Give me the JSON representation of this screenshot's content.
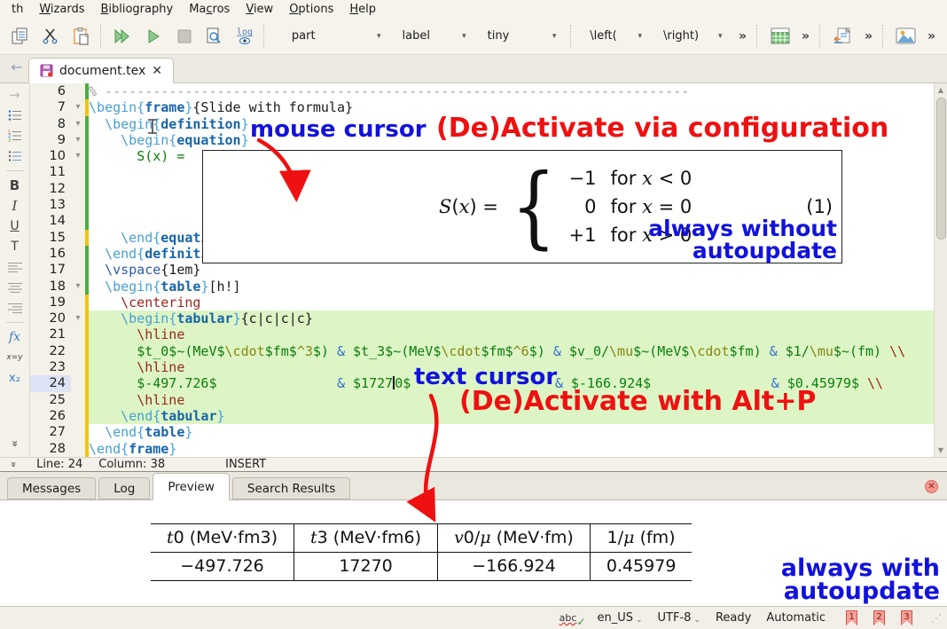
{
  "menu": {
    "items": [
      {
        "name": "overflow",
        "pre": "th",
        "key": "",
        "post": ""
      },
      {
        "name": "wizards",
        "pre": "",
        "key": "W",
        "post": "izards"
      },
      {
        "name": "bibliography",
        "pre": "",
        "key": "B",
        "post": "ibliography"
      },
      {
        "name": "macros",
        "pre": "Ma",
        "key": "c",
        "post": "ros"
      },
      {
        "name": "view",
        "pre": "",
        "key": "V",
        "post": "iew"
      },
      {
        "name": "options",
        "pre": "",
        "key": "O",
        "post": "ptions"
      },
      {
        "name": "help",
        "pre": "",
        "key": "H",
        "post": "elp"
      }
    ]
  },
  "toolbar": {
    "part_dropdown": "part",
    "label_dropdown": "label",
    "tiny_dropdown": "tiny",
    "left_dropdown": "\\left(",
    "right_dropdown": "\\right)",
    "overflow": "»",
    "arrow": "▾"
  },
  "tabbar": {
    "back": "←",
    "tab_title": "document.tex",
    "close": "✕"
  },
  "sidebar": {
    "items": [
      {
        "name": "nav-forward",
        "g": "→",
        "style": "color:#b9b9b9;font-size:15px"
      },
      {
        "name": "bullet-list",
        "svg": "list-dot"
      },
      {
        "name": "numbered-list",
        "svg": "list-num"
      },
      {
        "name": "description-list",
        "svg": "list-dot2"
      },
      {
        "name": "divider"
      },
      {
        "name": "bold",
        "g": "B",
        "style": "font-weight:bold;font-size:15px"
      },
      {
        "name": "italic",
        "g": "I",
        "style": "font-style:italic;font-family:'DejaVu Serif',serif;font-size:15px"
      },
      {
        "name": "underline",
        "g": "U",
        "style": "text-decoration:underline;font-size:14px"
      },
      {
        "name": "text-style",
        "g": "T",
        "style": "font-size:14px"
      },
      {
        "name": "align-left",
        "svg": "al"
      },
      {
        "name": "align-center",
        "svg": "ac"
      },
      {
        "name": "align-right",
        "svg": "ar"
      },
      {
        "name": "divider"
      },
      {
        "name": "math-inline",
        "g": "fx",
        "style": "font-style:italic;font-family:'DejaVu Serif',serif;color:#3a7cc0;font-size:14px"
      },
      {
        "name": "math-display",
        "g": "x=y",
        "style": "font-style:italic;font-size:9px"
      },
      {
        "name": "subscript",
        "g": "x₂",
        "style": "font-size:13px;color:#3a7cc0"
      },
      {
        "name": "collapse",
        "g": "»",
        "style": "transform:rotate(90deg);color:#666;font-size:12px;font-weight:bold",
        "bottom": true
      }
    ]
  },
  "editor": {
    "lines": [
      {
        "n": 6,
        "fold": false,
        "bar": "g",
        "hl": false,
        "segs": [
          [
            "c",
            "% -------------------------------------------------------------------------"
          ]
        ]
      },
      {
        "n": 7,
        "fold": true,
        "bar": "y",
        "hl": false,
        "segs": [
          [
            "k",
            "\\begin{"
          ],
          [
            "e",
            "frame"
          ],
          [
            "k",
            "}"
          ],
          [
            "p",
            "{Slide with formula}"
          ]
        ]
      },
      {
        "n": 8,
        "fold": true,
        "bar": "g",
        "hl": false,
        "segs": [
          [
            "p",
            "  "
          ],
          [
            "k",
            "\\begin{"
          ],
          [
            "e",
            "definition"
          ],
          [
            "k",
            "}"
          ]
        ]
      },
      {
        "n": 9,
        "fold": true,
        "bar": "g",
        "hl": false,
        "segs": [
          [
            "p",
            "    "
          ],
          [
            "k",
            "\\begin{"
          ],
          [
            "e",
            "equation"
          ],
          [
            "k",
            "}"
          ]
        ]
      },
      {
        "n": 10,
        "fold": true,
        "bar": "g",
        "hl": false,
        "segs": [
          [
            "p",
            "      "
          ],
          [
            "m",
            "S(x) = "
          ]
        ]
      },
      {
        "n": 11,
        "fold": false,
        "bar": "g",
        "hl": false,
        "segs": []
      },
      {
        "n": 12,
        "fold": false,
        "bar": "g",
        "hl": false,
        "segs": []
      },
      {
        "n": 13,
        "fold": false,
        "bar": "g",
        "hl": false,
        "segs": []
      },
      {
        "n": 14,
        "fold": false,
        "bar": "g",
        "hl": false,
        "segs": []
      },
      {
        "n": 15,
        "fold": false,
        "bar": "y",
        "hl": false,
        "segs": [
          [
            "p",
            "    "
          ],
          [
            "k",
            "\\end{"
          ],
          [
            "e",
            "equation"
          ],
          [
            "k",
            "}"
          ]
        ]
      },
      {
        "n": 16,
        "fold": false,
        "bar": "g",
        "hl": false,
        "segs": [
          [
            "p",
            "  "
          ],
          [
            "k",
            "\\end{"
          ],
          [
            "e",
            "definition"
          ],
          [
            "k",
            "}"
          ]
        ]
      },
      {
        "n": 17,
        "fold": false,
        "bar": "g",
        "hl": false,
        "segs": [
          [
            "p",
            "  "
          ],
          [
            "v",
            "\\vspace"
          ],
          [
            "p",
            "{1em}"
          ]
        ]
      },
      {
        "n": 18,
        "fold": true,
        "bar": "g",
        "hl": false,
        "segs": [
          [
            "p",
            "  "
          ],
          [
            "k",
            "\\begin{"
          ],
          [
            "e",
            "table"
          ],
          [
            "k",
            "}"
          ],
          [
            "p",
            "[h!]"
          ]
        ]
      },
      {
        "n": 19,
        "fold": false,
        "bar": "y",
        "hl": false,
        "segs": [
          [
            "p",
            "    "
          ],
          [
            "r",
            "\\centering"
          ]
        ]
      },
      {
        "n": 20,
        "fold": true,
        "bar": "y",
        "hl": true,
        "segs": [
          [
            "p",
            "    "
          ],
          [
            "k",
            "\\begin{"
          ],
          [
            "e",
            "tabular"
          ],
          [
            "k",
            "}"
          ],
          [
            "p",
            "{c|c|c|c}"
          ]
        ]
      },
      {
        "n": 21,
        "fold": false,
        "bar": "y",
        "hl": true,
        "segs": [
          [
            "p",
            "      "
          ],
          [
            "r",
            "\\hline"
          ]
        ]
      },
      {
        "n": 22,
        "fold": false,
        "bar": "y",
        "hl": true,
        "segs": [
          [
            "p",
            "      "
          ],
          [
            "m",
            "$t_0$~(MeV$"
          ],
          [
            "o",
            "\\cdot"
          ],
          [
            "m",
            "$fm$"
          ],
          [
            "o",
            "^3"
          ],
          [
            "m",
            "$)"
          ],
          [
            "p",
            " "
          ],
          [
            "a",
            "&"
          ],
          [
            "p",
            " "
          ],
          [
            "m",
            "$t_3$~(MeV$"
          ],
          [
            "o",
            "\\cdot"
          ],
          [
            "m",
            "$fm$"
          ],
          [
            "o",
            "^6"
          ],
          [
            "m",
            "$)"
          ],
          [
            "p",
            " "
          ],
          [
            "a",
            "&"
          ],
          [
            "p",
            " "
          ],
          [
            "m",
            "$v_0/"
          ],
          [
            "o",
            "\\mu"
          ],
          [
            "m",
            "$~(MeV$"
          ],
          [
            "o",
            "\\cdot"
          ],
          [
            "m",
            "$fm)"
          ],
          [
            "p",
            " "
          ],
          [
            "a",
            "&"
          ],
          [
            "p",
            " "
          ],
          [
            "m",
            "$1/"
          ],
          [
            "o",
            "\\mu"
          ],
          [
            "m",
            "$~(fm)"
          ],
          [
            "p",
            " "
          ],
          [
            "r",
            "\\\\"
          ]
        ]
      },
      {
        "n": 23,
        "fold": false,
        "bar": "y",
        "hl": true,
        "segs": [
          [
            "p",
            "      "
          ],
          [
            "r",
            "\\hline"
          ]
        ]
      },
      {
        "n": 24,
        "cur": true,
        "fold": false,
        "bar": "y",
        "hl": true,
        "segs": [
          [
            "p",
            "      "
          ],
          [
            "m",
            "$-497.726$"
          ],
          [
            "p",
            "               "
          ],
          [
            "a",
            "&"
          ],
          [
            "p",
            " "
          ],
          [
            "m",
            "$1727"
          ],
          [
            "caret",
            ""
          ],
          [
            "m",
            "0$"
          ],
          [
            "p",
            "                  "
          ],
          [
            "a",
            "&"
          ],
          [
            "p",
            " "
          ],
          [
            "m",
            "$-166.924$"
          ],
          [
            "p",
            "               "
          ],
          [
            "a",
            "&"
          ],
          [
            "p",
            " "
          ],
          [
            "m",
            "$0.45979$"
          ],
          [
            "p",
            " "
          ],
          [
            "r",
            "\\\\"
          ]
        ]
      },
      {
        "n": 25,
        "fold": false,
        "bar": "y",
        "hl": true,
        "segs": [
          [
            "p",
            "      "
          ],
          [
            "r",
            "\\hline"
          ]
        ]
      },
      {
        "n": 26,
        "fold": false,
        "bar": "y",
        "hl": true,
        "segs": [
          [
            "p",
            "    "
          ],
          [
            "k",
            "\\end{"
          ],
          [
            "e",
            "tabular"
          ],
          [
            "k",
            "}"
          ]
        ]
      },
      {
        "n": 27,
        "fold": false,
        "bar": "y",
        "hl": false,
        "segs": [
          [
            "p",
            "  "
          ],
          [
            "k",
            "\\end{"
          ],
          [
            "e",
            "table"
          ],
          [
            "k",
            "}"
          ]
        ]
      },
      {
        "n": 28,
        "fold": false,
        "bar": "y",
        "hl": false,
        "segs": [
          [
            "k",
            "\\end{"
          ],
          [
            "e",
            "frame"
          ],
          [
            "k",
            "}"
          ]
        ]
      }
    ],
    "status": {
      "line": "Line: 24",
      "column": "Column: 38",
      "mode": "INSERT"
    }
  },
  "eq_preview": {
    "lhs": [
      [
        "i",
        "S"
      ],
      [
        "u",
        "("
      ],
      [
        "i",
        "x"
      ],
      [
        "u",
        ") ="
      ]
    ],
    "rows": [
      {
        "v": "−1",
        "c": [
          [
            "u",
            "for "
          ],
          [
            "i",
            "x"
          ],
          [
            "u",
            " < 0"
          ]
        ]
      },
      {
        "v": "0",
        "c": [
          [
            "u",
            "for "
          ],
          [
            "i",
            "x"
          ],
          [
            "u",
            " = 0"
          ]
        ]
      },
      {
        "v": "+1",
        "c": [
          [
            "u",
            "for "
          ],
          [
            "i",
            "x"
          ],
          [
            "u",
            " > 0"
          ]
        ]
      }
    ],
    "eqnum": "(1)",
    "note_line1": "always without",
    "note_line2": "autoupdate"
  },
  "annotations": {
    "mouse_cursor": "mouse cursor",
    "config": "(De)Activate via configuration",
    "text_cursor": "text cursor",
    "altp": "(De)Activate with Alt+P",
    "with_line1": "always with",
    "with_line2": "autoupdate",
    "blue": "#1212dd",
    "red": "#ee1111"
  },
  "panel": {
    "tabs": [
      "Messages",
      "Log",
      "Preview",
      "Search Results"
    ],
    "active": "Preview",
    "close": "✕"
  },
  "preview_table": {
    "type": "table",
    "headers": [
      [
        [
          "i",
          "t"
        ],
        [
          "sub",
          "0"
        ],
        [
          "u",
          " (MeV·fm"
        ],
        [
          "sup",
          "3"
        ],
        [
          "u",
          ")"
        ]
      ],
      [
        [
          "i",
          "t"
        ],
        [
          "sub",
          "3"
        ],
        [
          "u",
          " (MeV·fm"
        ],
        [
          "sup",
          "6"
        ],
        [
          "u",
          ")"
        ]
      ],
      [
        [
          "i",
          "v"
        ],
        [
          "sub",
          "0"
        ],
        [
          "u",
          "/"
        ],
        [
          "i",
          "μ"
        ],
        [
          "u",
          " (MeV·fm)"
        ]
      ],
      [
        [
          "u",
          "1/"
        ],
        [
          "i",
          "μ"
        ],
        [
          "u",
          " (fm)"
        ]
      ]
    ],
    "values": [
      "−497.726",
      "17270",
      "−166.924",
      "0.45979"
    ]
  },
  "statusbar": {
    "spell": "abc",
    "spell_check": "✓",
    "language": "en_US",
    "encoding": "UTF-8",
    "state": "Ready",
    "line_ending": "Automatic",
    "bookmarks": [
      "1",
      "2",
      "3"
    ],
    "arrow": "⌄",
    "grip": "⋰"
  }
}
